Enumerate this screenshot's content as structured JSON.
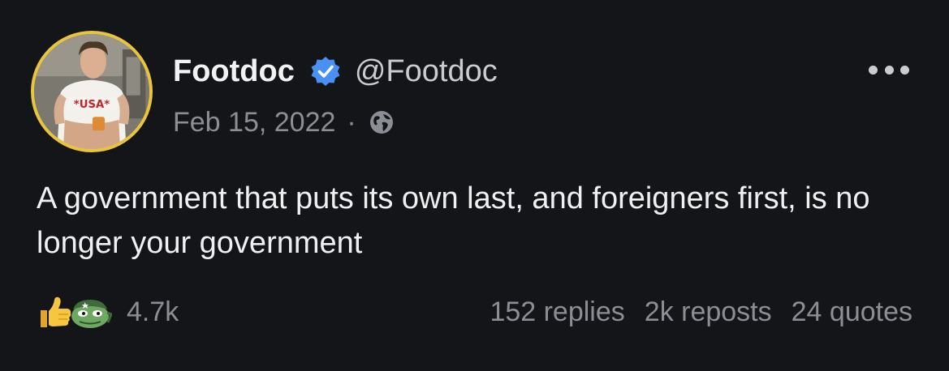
{
  "author": {
    "display_name": "Footdoc",
    "handle": "@Footdoc",
    "verified_icon": "verified-check-icon",
    "avatar_border_color": "#e8c53a"
  },
  "meta": {
    "date": "Feb 15, 2022",
    "separator": "·",
    "visibility_icon": "globe-icon"
  },
  "menu": {
    "icon": "more-options-icon"
  },
  "post": {
    "text": "A government that puts its own last, and foreigners first, is no longer your government"
  },
  "reactions": {
    "icons": [
      "thumbs-up-icon",
      "frog-emoji-icon"
    ],
    "count": "4.7k"
  },
  "counts": {
    "replies": "152 replies",
    "reposts": "2k reposts",
    "quotes": "24 quotes"
  },
  "colors": {
    "background": "#141518",
    "text": "#e7e9ea",
    "muted": "#8b8f95",
    "verified_blue": "#4a8ff2"
  }
}
